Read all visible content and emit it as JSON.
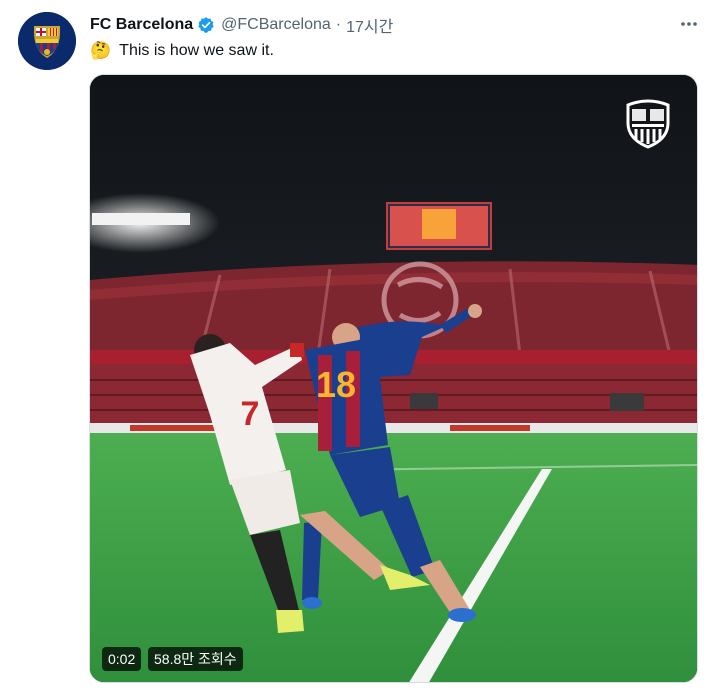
{
  "tweet": {
    "author_name": "FC Barcelona",
    "handle": "@FCBarcelona",
    "separator": "·",
    "time": "17시간",
    "emoji": "🤔",
    "text": "This is how we saw it.",
    "more_icon": "more-horizontal-icon",
    "verified_icon": "verified-badge-icon"
  },
  "media": {
    "elapsed": "0:02",
    "views": "58.8만 조회수",
    "player_numbers": {
      "barcelona": "18",
      "sevilla": "7"
    },
    "colors": {
      "barca_blue": "#1a3f8f",
      "barca_red": "#a81f3b",
      "twitter_verified": "#1d9bf0",
      "pitch_green": "#3fa24a"
    }
  }
}
